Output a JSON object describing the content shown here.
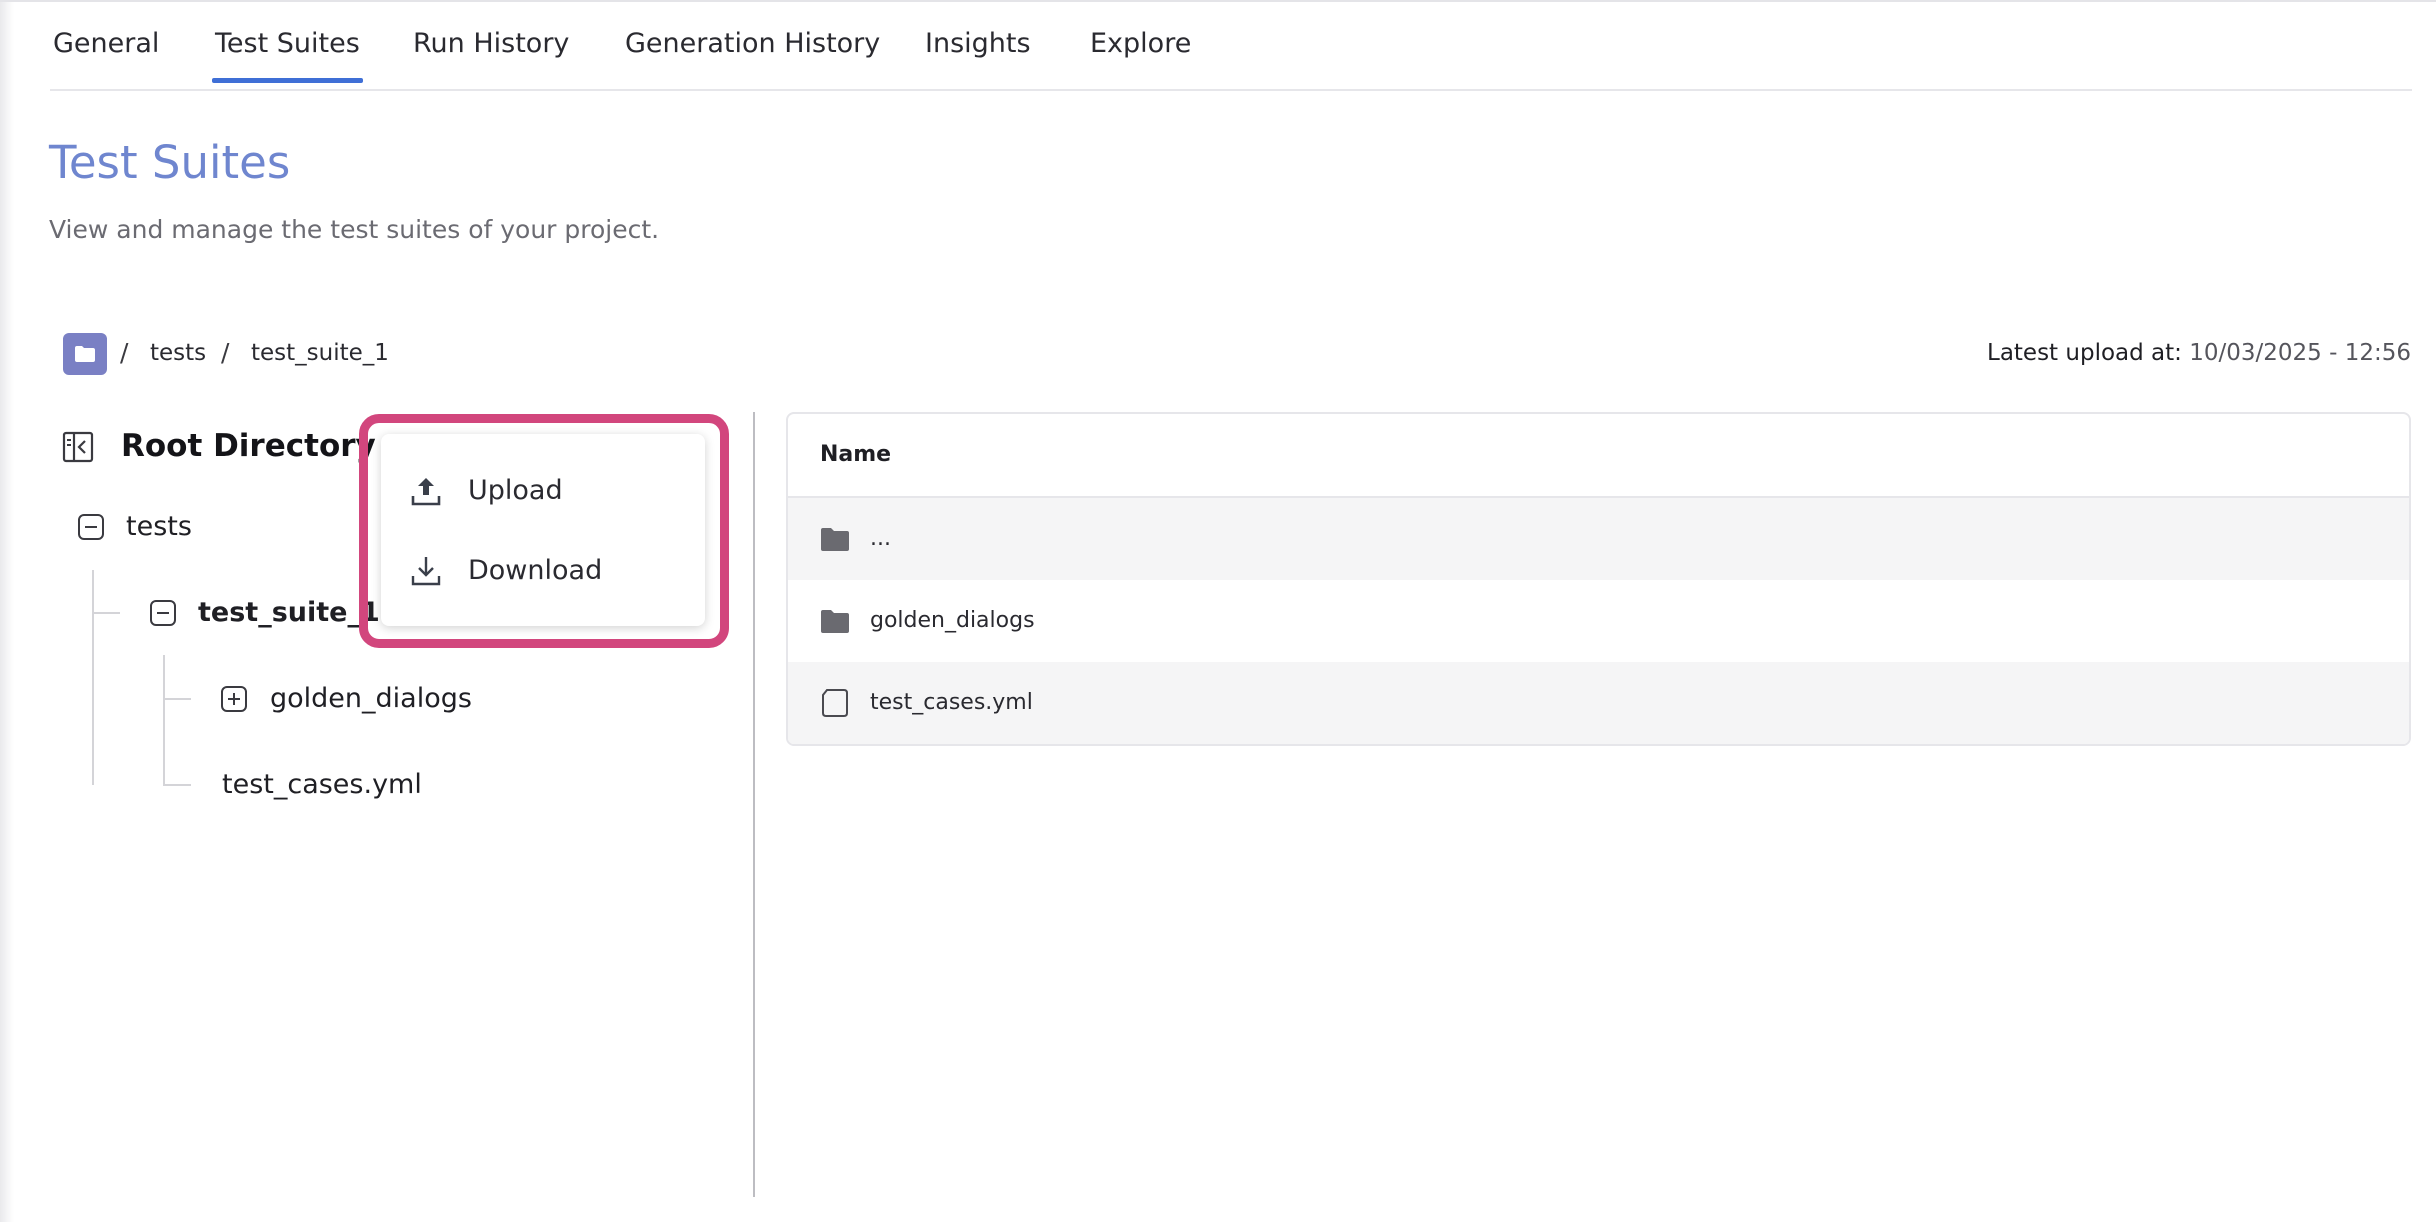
{
  "tabs": [
    {
      "label": "General"
    },
    {
      "label": "Test Suites",
      "active": true
    },
    {
      "label": "Run History"
    },
    {
      "label": "Generation History"
    },
    {
      "label": "Insights"
    },
    {
      "label": "Explore"
    }
  ],
  "page": {
    "title": "Test Suites",
    "subtitle": "View and manage the test suites of your project."
  },
  "breadcrumb": {
    "separator": "/",
    "items": [
      "tests",
      "test_suite_1"
    ]
  },
  "latest_upload": {
    "label": "Latest upload at:",
    "value": "10/03/2025 - 12:56"
  },
  "tree": {
    "root_title": "Root Directory",
    "nodes": [
      {
        "label": "tests",
        "state": "expanded"
      },
      {
        "label": "test_suite_1",
        "state": "expanded"
      },
      {
        "label": "golden_dialogs",
        "state": "collapsed"
      },
      {
        "label": "test_cases.yml",
        "state": "file"
      }
    ]
  },
  "menu": {
    "items": [
      {
        "label": "Upload",
        "icon": "upload-icon"
      },
      {
        "label": "Download",
        "icon": "download-icon"
      }
    ]
  },
  "table": {
    "header": "Name",
    "rows": [
      {
        "label": "...",
        "icon": "folder-icon"
      },
      {
        "label": "golden_dialogs",
        "icon": "folder-icon"
      },
      {
        "label": "test_cases.yml",
        "icon": "file-icon"
      }
    ]
  },
  "colors": {
    "accent": "#3f6fd6",
    "title": "#6f86cf",
    "breadcrumb_folder": "#7a80c4",
    "highlight": "#d2467d"
  }
}
